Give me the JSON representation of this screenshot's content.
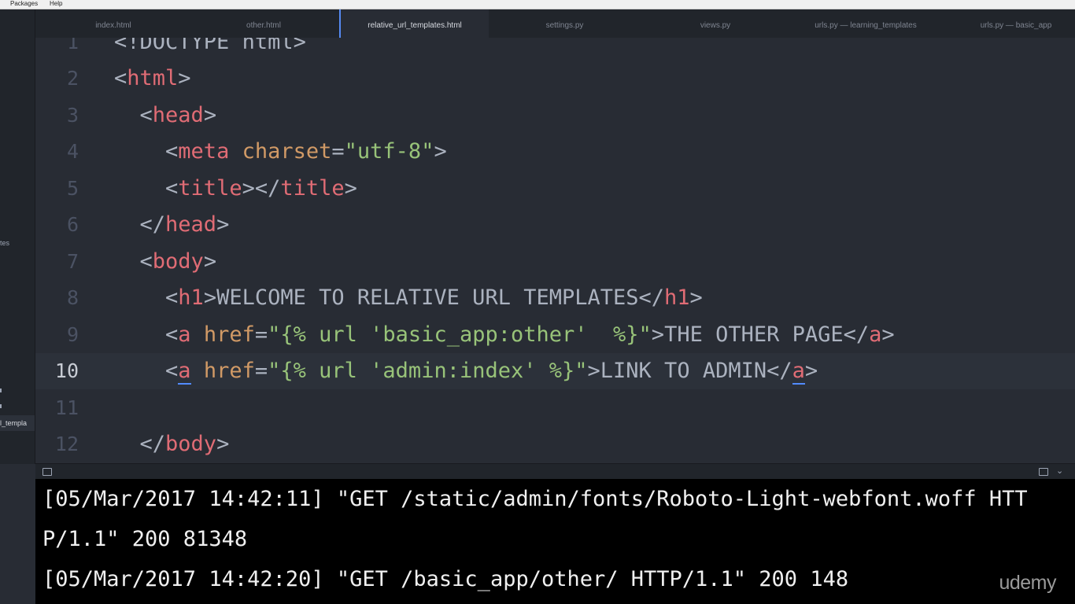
{
  "menubar": {
    "items": [
      "Packages",
      "Help"
    ]
  },
  "sidebar": {
    "items": [
      "tes",
      "l_templa"
    ]
  },
  "tabs": [
    {
      "label": "index.html",
      "active": false
    },
    {
      "label": "other.html",
      "active": false
    },
    {
      "label": "relative_url_templates.html",
      "active": true
    },
    {
      "label": "settings.py",
      "active": false
    },
    {
      "label": "views.py",
      "active": false
    },
    {
      "label": "urls.py — learning_templates",
      "active": false
    },
    {
      "label": "urls.py — basic_app",
      "active": false
    }
  ],
  "editor": {
    "line_numbers": [
      "1",
      "2",
      "3",
      "4",
      "5",
      "6",
      "7",
      "8",
      "9",
      "10",
      "11",
      "12"
    ],
    "current_line": "10",
    "lines": {
      "l1": {
        "open": "<",
        "body": "!DOCTYPE html",
        "close": ">"
      },
      "l2": {
        "lt": "<",
        "tag": "html",
        "gt": ">"
      },
      "l3": {
        "lt": "<",
        "tag": "head",
        "gt": ">"
      },
      "l4": {
        "lt": "<",
        "tag": "meta",
        "attr": "charset",
        "eq": "=",
        "val": "\"utf-8\"",
        "gt": ">"
      },
      "l5": {
        "lt": "<",
        "tag": "title",
        "gt": ">",
        "lt2": "</",
        "tag2": "title",
        "gt2": ">"
      },
      "l6": {
        "lt": "</",
        "tag": "head",
        "gt": ">"
      },
      "l7": {
        "lt": "<",
        "tag": "body",
        "gt": ">"
      },
      "l8": {
        "lt": "<",
        "tag": "h1",
        "gt": ">",
        "text": "WELCOME TO RELATIVE URL TEMPLATES",
        "lt2": "</",
        "tag2": "h1",
        "gt2": ">"
      },
      "l9": {
        "lt": "<",
        "tag": "a",
        "attr": "href",
        "eq": "=",
        "val": "\"{% url 'basic_app:other'  %}\"",
        "gt": ">",
        "text": "THE OTHER PAGE",
        "lt2": "</",
        "tag2": "a",
        "gt2": ">"
      },
      "l10": {
        "lt": "<",
        "tag": "a",
        "attr": "href",
        "eq": "=",
        "val": "\"{% url 'admin:index' %}\"",
        "gt": ">",
        "text": "LINK TO ADMIN",
        "lt2": "</",
        "tag2": "a",
        "gt2": ">"
      },
      "l12": {
        "lt": "</",
        "tag": "body",
        "gt": ">"
      }
    }
  },
  "terminal": {
    "lines": [
      "[05/Mar/2017 14:42:11] \"GET /static/admin/fonts/Roboto-Light-webfont.woff HTT",
      "P/1.1\" 200 81348",
      "[05/Mar/2017 14:42:20] \"GET /basic_app/other/ HTTP/1.1\" 200 148"
    ]
  },
  "watermark": "udemy",
  "colors": {
    "tag": "#e06c75",
    "attribute": "#d19a66",
    "string": "#98c379",
    "punctuation": "#abb2bf",
    "cursor": "#528bff"
  }
}
